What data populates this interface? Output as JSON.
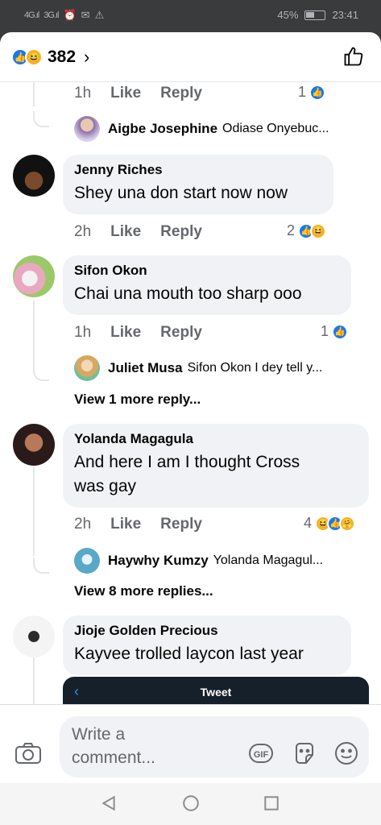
{
  "status_bar": {
    "signal_1": "4G.ıl",
    "signal_2": "3G.ıl",
    "icons": [
      "alarm-icon",
      "mail-icon",
      "warning-icon"
    ],
    "battery": "45%",
    "time": "23:41"
  },
  "header": {
    "reaction_icons": [
      "like",
      "haha"
    ],
    "reaction_count": "382",
    "chevron": "›"
  },
  "comments": [
    {
      "id": "top-reply-meta",
      "time": "1h",
      "like": "Like",
      "reply": "Reply",
      "reactions": "1",
      "reply_preview": {
        "name": "Aigbe Josephine",
        "text": "Odiase Onyebuc..."
      }
    },
    {
      "id": "jenny",
      "name": "Jenny Riches",
      "text": "Shey una don start now now",
      "time": "2h",
      "like": "Like",
      "reply": "Reply",
      "reactions": "2"
    },
    {
      "id": "sifon",
      "name": "Sifon Okon",
      "text": "Chai una mouth too sharp ooo",
      "time": "1h",
      "like": "Like",
      "reply": "Reply",
      "reactions": "1",
      "reply_preview": {
        "name": "Juliet Musa",
        "text": "Sifon Okon I dey tell y..."
      },
      "view_more": "View 1 more reply..."
    },
    {
      "id": "yolanda",
      "name": "Yolanda Magagula",
      "text_line1": "And here I am I thought Cross",
      "text_line2": "was gay",
      "time": "2h",
      "like": "Like",
      "reply": "Reply",
      "reactions": "4",
      "reply_preview": {
        "name": "Haywhy Kumzy",
        "text": "Yolanda Magagul..."
      },
      "view_more": "View 8 more replies..."
    },
    {
      "id": "jioje",
      "name": "Jioje Golden Precious",
      "text": "Kayvee trolled laycon last year"
    }
  ],
  "tweet_embed": {
    "back": "‹",
    "title": "Tweet"
  },
  "composer": {
    "placeholder_line1": "Write a",
    "placeholder_line2": "comment...",
    "gif_label": "GIF"
  },
  "colors": {
    "like_blue": "#1877f2",
    "haha_yellow": "#f7b125",
    "bubble_bg": "#f0f2f5",
    "meta_gray": "#65676b"
  }
}
